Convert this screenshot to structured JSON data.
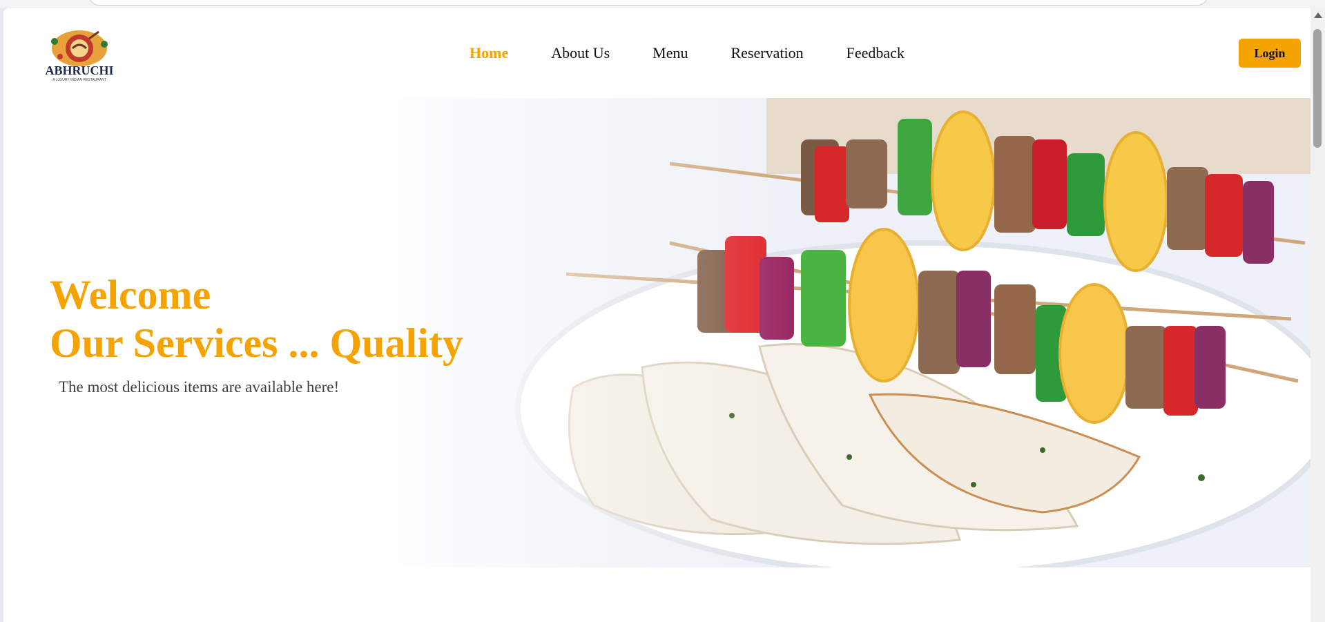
{
  "header": {
    "logo_text": "ABHRUCHI",
    "logo_tagline": "A LUXURY INDIAN RESTAURANT",
    "nav": [
      {
        "label": "Home",
        "active": true
      },
      {
        "label": "About Us",
        "active": false
      },
      {
        "label": "Menu",
        "active": false
      },
      {
        "label": "Reservation",
        "active": false
      },
      {
        "label": "Feedback",
        "active": false
      }
    ],
    "login_label": "Login"
  },
  "hero": {
    "title_line1": "Welcome",
    "title_line2": "Our Services ... Quality",
    "subtitle": "The most delicious items are available here!",
    "image": "kebab-skewers-with-naan-photo"
  },
  "colors": {
    "accent": "#f5a300",
    "nav_text": "#111111",
    "subtitle_text": "#3f3f3f"
  }
}
